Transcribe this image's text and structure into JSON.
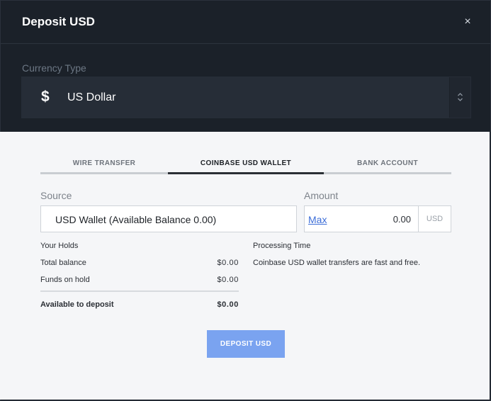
{
  "header": {
    "title": "Deposit USD",
    "close_glyph": "×"
  },
  "currency": {
    "label": "Currency Type",
    "symbol": "$",
    "selected": "US Dollar"
  },
  "tabs": [
    {
      "label": "WIRE TRANSFER",
      "active": false
    },
    {
      "label": "COINBASE USD WALLET",
      "active": true
    },
    {
      "label": "BANK ACCOUNT",
      "active": false
    }
  ],
  "source": {
    "label": "Source",
    "value": "USD Wallet (Available Balance 0.00)"
  },
  "amount": {
    "label": "Amount",
    "max_label": "Max",
    "value": "0.00",
    "unit": "USD"
  },
  "holds": {
    "title": "Your Holds",
    "rows": [
      {
        "label": "Total balance",
        "value": "$0.00"
      },
      {
        "label": "Funds on hold",
        "value": "$0.00"
      }
    ],
    "total": {
      "label": "Available to deposit",
      "value": "$0.00"
    }
  },
  "processing": {
    "title": "Processing Time",
    "text": "Coinbase USD wallet transfers are fast and free."
  },
  "deposit_button": {
    "label": "DEPOSIT USD"
  },
  "colors": {
    "dark_bg": "#1b2129",
    "panel_bg": "#f5f6f8",
    "button": "#7aa3f0",
    "link": "#3d6ed8"
  }
}
